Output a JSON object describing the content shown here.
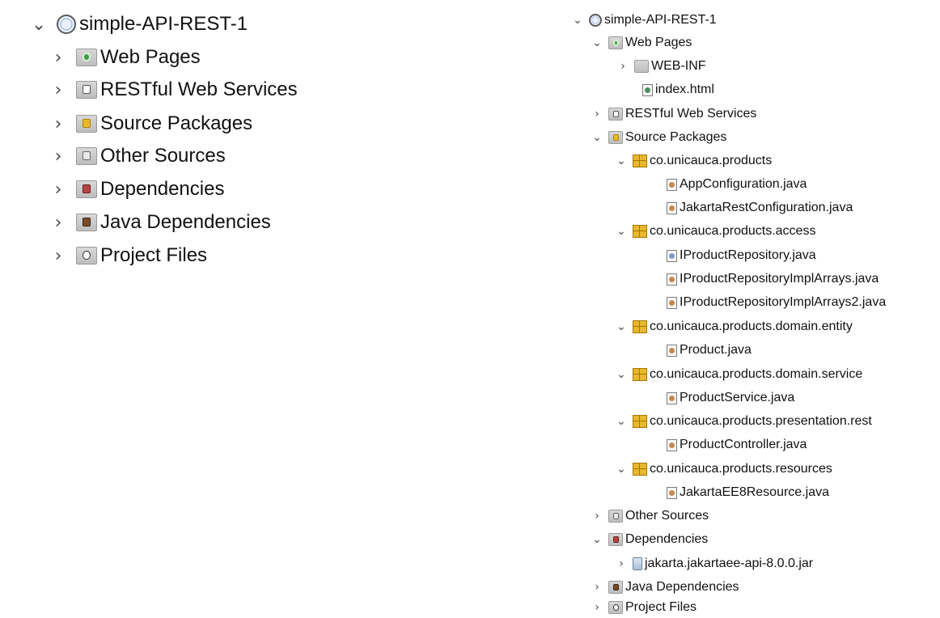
{
  "left_tree": {
    "project": {
      "label": "simple-API-REST-1",
      "icon": "globe-project-icon",
      "expanded": true
    },
    "children": [
      {
        "label": "Web Pages",
        "icon": "web-pages-folder-icon"
      },
      {
        "label": "RESTful Web Services",
        "icon": "restful-folder-icon"
      },
      {
        "label": "Source Packages",
        "icon": "source-packages-folder-icon"
      },
      {
        "label": "Other Sources",
        "icon": "other-sources-folder-icon"
      },
      {
        "label": "Dependencies",
        "icon": "dependencies-folder-icon"
      },
      {
        "label": "Java Dependencies",
        "icon": "java-dependencies-folder-icon"
      },
      {
        "label": "Project Files",
        "icon": "project-files-folder-icon"
      }
    ]
  },
  "right_tree": {
    "project": {
      "label": "simple-API-REST-1"
    },
    "web_pages": {
      "label": "Web Pages",
      "web_inf": "WEB-INF",
      "index": "index.html"
    },
    "restful": {
      "label": "RESTful Web Services"
    },
    "source_packages": {
      "label": "Source Packages",
      "packages": [
        {
          "label": "co.unicauca.products",
          "files": [
            "AppConfiguration.java",
            "JakartaRestConfiguration.java"
          ]
        },
        {
          "label": "co.unicauca.products.access",
          "files": [
            "IProductRepository.java",
            "IProductRepositoryImplArrays.java",
            "IProductRepositoryImplArrays2.java"
          ]
        },
        {
          "label": "co.unicauca.products.domain.entity",
          "files": [
            "Product.java"
          ]
        },
        {
          "label": "co.unicauca.products.domain.service",
          "files": [
            "ProductService.java"
          ]
        },
        {
          "label": "co.unicauca.products.presentation.rest",
          "files": [
            "ProductController.java"
          ]
        },
        {
          "label": "co.unicauca.products.resources",
          "files": [
            "JakartaEE8Resource.java"
          ]
        }
      ]
    },
    "other_sources": {
      "label": "Other Sources"
    },
    "dependencies": {
      "label": "Dependencies",
      "jar": "jakarta.jakartaee-api-8.0.0.jar"
    },
    "java_dependencies": {
      "label": "Java Dependencies"
    },
    "project_files": {
      "label": "Project Files"
    }
  }
}
